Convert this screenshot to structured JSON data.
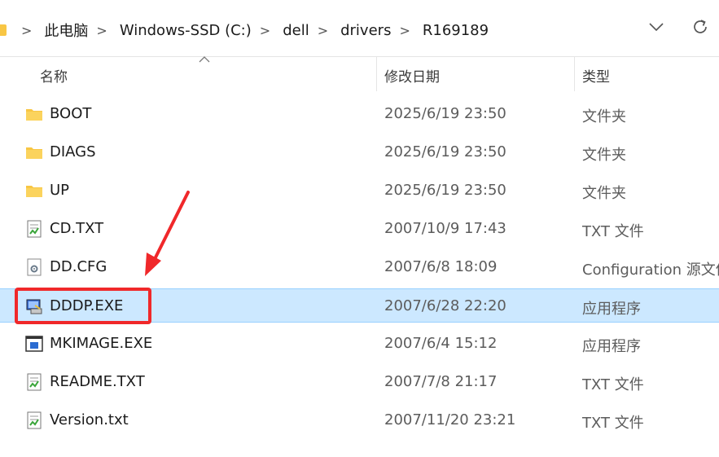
{
  "address": {
    "crumbs": [
      "此电脑",
      "Windows-SSD (C:)",
      "dell",
      "drivers",
      "R169189"
    ],
    "separator": ">"
  },
  "columns": {
    "name": "名称",
    "date": "修改日期",
    "type": "类型"
  },
  "files": [
    {
      "name": "BOOT",
      "date": "2025/6/19 23:50",
      "type": "文件夹",
      "icon": "folder-icon"
    },
    {
      "name": "DIAGS",
      "date": "2025/6/19 23:50",
      "type": "文件夹",
      "icon": "folder-icon"
    },
    {
      "name": "UP",
      "date": "2025/6/19 23:50",
      "type": "文件夹",
      "icon": "folder-icon"
    },
    {
      "name": "CD.TXT",
      "date": "2007/10/9 17:43",
      "type": "TXT 文件",
      "icon": "text-file-icon"
    },
    {
      "name": "DD.CFG",
      "date": "2007/6/8 18:09",
      "type": "Configuration 源文件",
      "icon": "config-file-icon"
    },
    {
      "name": "DDDP.EXE",
      "date": "2007/6/28 22:20",
      "type": "应用程序",
      "icon": "installer-exe-icon",
      "selected": true
    },
    {
      "name": "MKIMAGE.EXE",
      "date": "2007/6/4 15:12",
      "type": "应用程序",
      "icon": "exe-window-icon"
    },
    {
      "name": "README.TXT",
      "date": "2007/7/8 21:17",
      "type": "TXT 文件",
      "icon": "text-file-icon"
    },
    {
      "name": "Version.txt",
      "date": "2007/11/20 23:21",
      "type": "TXT 文件",
      "icon": "text-file-icon"
    }
  ],
  "colors": {
    "selection": "#cce8ff",
    "annotation": "#f0282a",
    "folder": "#f8c644"
  }
}
